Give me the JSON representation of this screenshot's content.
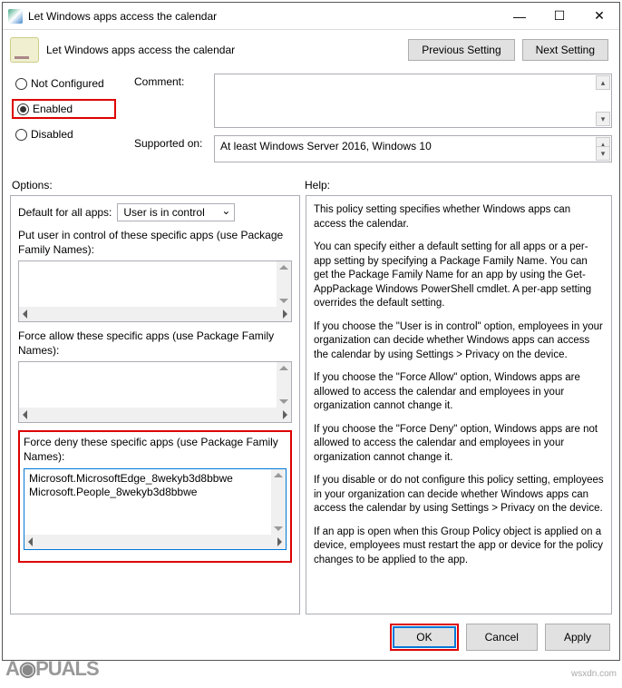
{
  "titlebar": {
    "title": "Let Windows apps access the calendar"
  },
  "header": {
    "text": "Let Windows apps access the calendar",
    "prev": "Previous Setting",
    "next": "Next Setting"
  },
  "radios": {
    "not_configured": "Not Configured",
    "enabled": "Enabled",
    "disabled": "Disabled"
  },
  "comment": {
    "label": "Comment:",
    "value": ""
  },
  "supported": {
    "label": "Supported on:",
    "value": "At least Windows Server 2016, Windows 10"
  },
  "sections": {
    "options": "Options:",
    "help": "Help:"
  },
  "options": {
    "default_label": "Default for all apps:",
    "default_value": "User is in control",
    "user_control_label": "Put user in control of these specific apps (use Package Family Names):",
    "force_allow_label": "Force allow these specific apps (use Package Family Names):",
    "force_deny_label": "Force deny these specific apps (use Package Family Names):",
    "force_deny_line1": "Microsoft.MicrosoftEdge_8wekyb3d8bbwe",
    "force_deny_line2": "Microsoft.People_8wekyb3d8bbwe"
  },
  "help": {
    "p1": "This policy setting specifies whether Windows apps can access the calendar.",
    "p2": "You can specify either a default setting for all apps or a per-app setting by specifying a Package Family Name. You can get the Package Family Name for an app by using the Get-AppPackage Windows PowerShell cmdlet. A per-app setting overrides the default setting.",
    "p3": "If you choose the \"User is in control\" option, employees in your organization can decide whether Windows apps can access the calendar by using Settings > Privacy on the device.",
    "p4": "If you choose the \"Force Allow\" option, Windows apps are allowed to access the calendar and employees in your organization cannot change it.",
    "p5": "If you choose the \"Force Deny\" option, Windows apps are not allowed to access the calendar and employees in your organization cannot change it.",
    "p6": "If you disable or do not configure this policy setting, employees in your organization can decide whether Windows apps can access the calendar by using Settings > Privacy on the device.",
    "p7": "If an app is open when this Group Policy object is applied on a device, employees must restart the app or device for the policy changes to be applied to the app."
  },
  "footer": {
    "ok": "OK",
    "cancel": "Cancel",
    "apply": "Apply"
  },
  "watermark": "APPUALS",
  "source": "wsxdn.com"
}
